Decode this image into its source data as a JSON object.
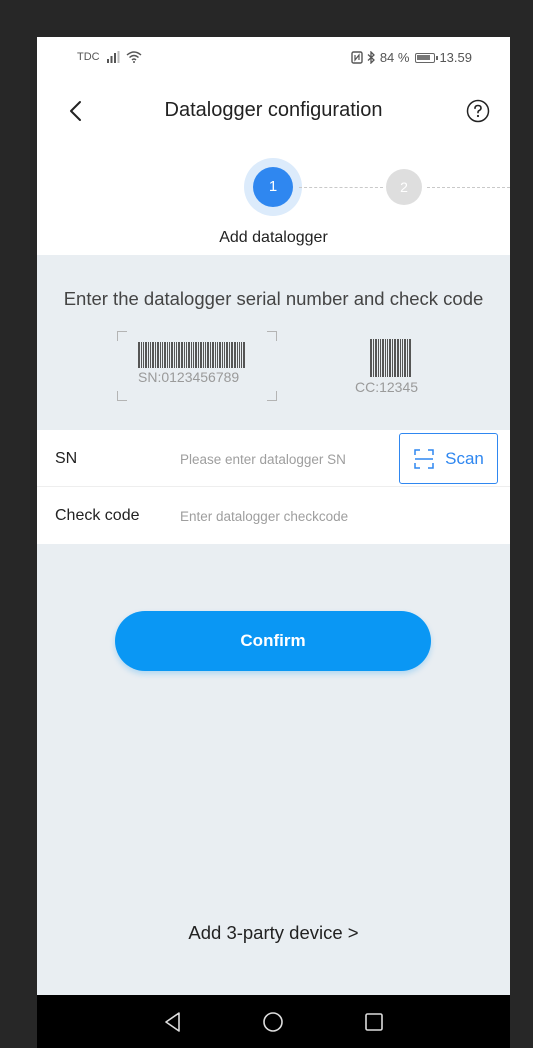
{
  "status_bar": {
    "carrier": "TDC",
    "battery_percent": "84 %",
    "time": "13.59",
    "signal_icon": "signal-icon",
    "wifi_icon": "wifi-icon",
    "nfc_icon": "nfc-icon",
    "bluetooth_icon": "bluetooth-icon",
    "battery_icon": "battery-icon"
  },
  "header": {
    "title": "Datalogger configuration",
    "back_icon": "back-chevron-icon",
    "help_icon": "help-icon"
  },
  "stepper": {
    "steps": [
      {
        "number": "1",
        "active": true
      },
      {
        "number": "2",
        "active": false
      }
    ],
    "current_label": "Add datalogger",
    "active_color": "#2f87f0",
    "inactive_color": "#dedede"
  },
  "instructions": {
    "text": "Enter the datalogger serial number and check code",
    "sn_example": "SN:0123456789",
    "cc_example": "CC:12345"
  },
  "form": {
    "sn_label": "SN",
    "sn_placeholder": "Please enter datalogger SN",
    "sn_value": "",
    "scan_label": "Scan",
    "scan_icon": "scan-icon",
    "check_code_label": "Check code",
    "check_code_placeholder": "Enter datalogger checkcode",
    "check_code_value": ""
  },
  "actions": {
    "confirm_label": "Confirm",
    "third_party_label": "Add 3-party device  >"
  },
  "system_nav": {
    "back_icon": "nav-back-icon",
    "home_icon": "nav-home-icon",
    "recents_icon": "nav-recents-icon"
  },
  "colors": {
    "primary": "#0a97f4",
    "accent_blue": "#2f87f0",
    "page_background": "#e9eef2"
  }
}
